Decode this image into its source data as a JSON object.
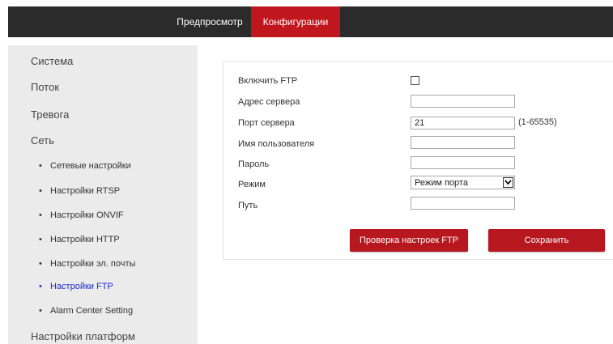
{
  "nav": {
    "preview": "Предпросмотр",
    "config": "Конфигурации"
  },
  "sidebar": {
    "items": [
      {
        "label": "Система"
      },
      {
        "label": "Поток"
      },
      {
        "label": "Тревога"
      },
      {
        "label": "Сеть"
      }
    ],
    "subitems": [
      {
        "label": "Сетевые настройки"
      },
      {
        "label": "Настройки RTSP"
      },
      {
        "label": "Настройки ONVIF"
      },
      {
        "label": "Настройки HTTP"
      },
      {
        "label": "Настройки эл. почты"
      },
      {
        "label": "Настройки FTP",
        "active": true
      },
      {
        "label": "Alarm Center Setting"
      }
    ],
    "last_item": "Настройки платформ",
    "bullet": "•"
  },
  "form": {
    "enable_ftp_label": "Включить FTP",
    "enable_ftp_checked": false,
    "server_address_label": "Адрес сервера",
    "server_address_value": "",
    "server_port_label": "Порт сервера",
    "server_port_value": "21",
    "port_hint": "(1-65535)",
    "username_label": "Имя пользователя",
    "username_value": "",
    "password_label": "Пароль",
    "password_value": "",
    "mode_label": "Режим",
    "mode_value": "Режим порта",
    "path_label": "Путь",
    "path_value": ""
  },
  "buttons": {
    "test": "Проверка настроек FTP",
    "save": "Сохранить"
  },
  "colors": {
    "accent": "#c0161d",
    "topbar": "#2b2b2b",
    "sidebar": "#ebebeb",
    "active_link": "#1c2bd1"
  }
}
